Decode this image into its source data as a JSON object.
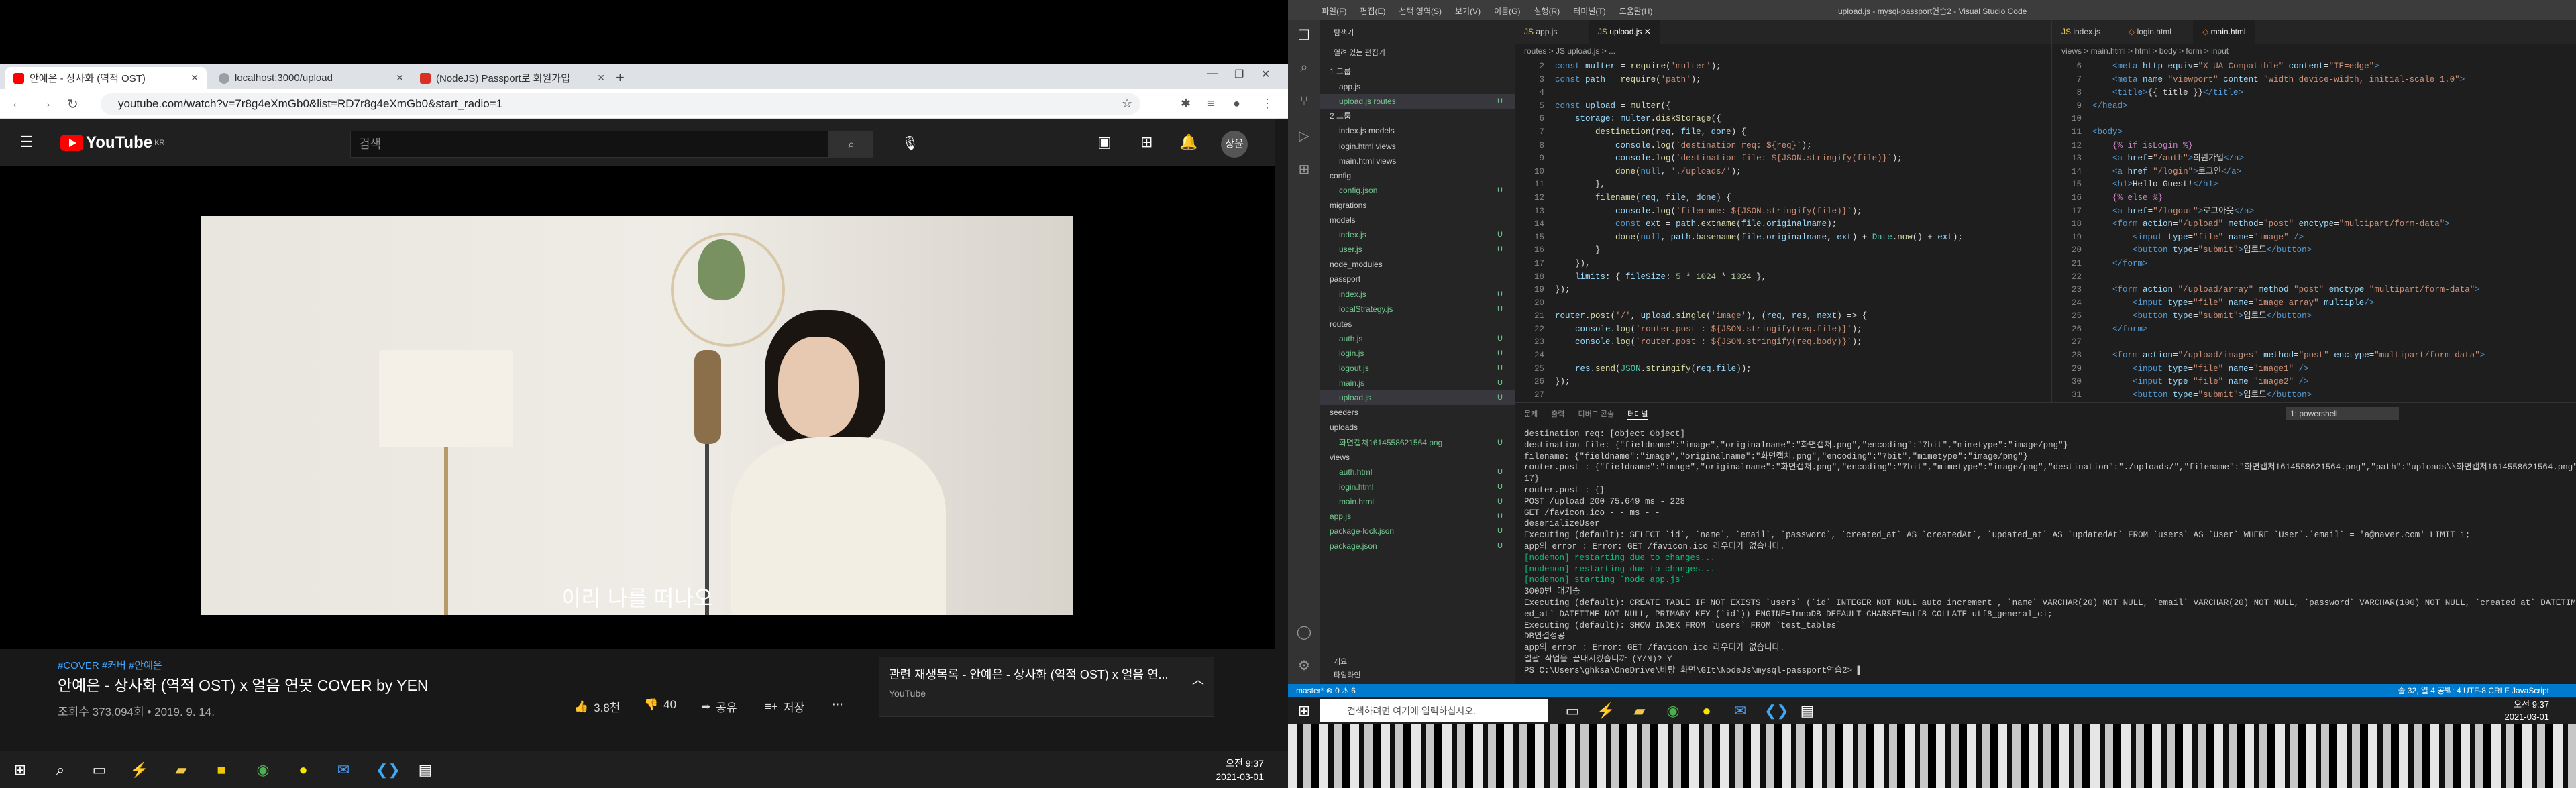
{
  "browser": {
    "tabs": [
      {
        "title": "안예은 - 상사화 (역적 OST)",
        "icon": "youtube-icon",
        "color": "#ff0000"
      },
      {
        "title": "localhost:3000/upload",
        "icon": "globe-icon",
        "color": "#5f6368"
      },
      {
        "title": "(NodeJS) Passport로 회원가입",
        "icon": "site-icon",
        "color": "#d93025"
      }
    ],
    "url": "youtube.com/watch?v=7r8g4eXmGb0&list=RD7r8g4eXmGb0&start_radio=1"
  },
  "youtube": {
    "logo_text": "YouTube",
    "logo_region": "KR",
    "search_placeholder": "검색",
    "avatar_text": "상윤",
    "caption": "이리 나를 떠나오",
    "tags": "#COVER #커버 #안예은",
    "video_title": "안예은 - 상사화 (역적 OST) x 얼음 연못 COVER by YEN",
    "views_date": "조회수 373,094회 • 2019. 9. 14.",
    "likes": "3.8천",
    "dislikes": "40",
    "share": "공유",
    "save": "저장",
    "playlist_title": "관련 재생목록 - 안예은 - 상사화 (역적 OST) x 얼음 연...",
    "playlist_sub": "YouTube"
  },
  "taskbar_left": {
    "time": "오전 9:37",
    "date": "2021-03-01"
  },
  "vscode": {
    "title": "upload.js - mysql-passport연습2 - Visual Studio Code",
    "menu": [
      "파일(F)",
      "편집(E)",
      "선택 영역(S)",
      "보기(V)",
      "이동(G)",
      "실행(R)",
      "터미널(T)",
      "도움말(H)"
    ],
    "explorer_header": "탐색기",
    "open_editors": "열려 있는 편집기",
    "project": "MYSQL-PASSPORT연습2",
    "outline": "개요",
    "timeline": "타임라인",
    "tree": [
      {
        "name": "1 그룹",
        "status": "",
        "level": 1
      },
      {
        "name": "app.js",
        "status": "",
        "level": 2
      },
      {
        "name": "upload.js routes",
        "status": "U",
        "level": 2
      },
      {
        "name": "2 그룹",
        "status": "",
        "level": 1
      },
      {
        "name": "index.js models",
        "status": "",
        "level": 2
      },
      {
        "name": "login.html views",
        "status": "",
        "level": 2
      },
      {
        "name": "main.html views",
        "status": "",
        "level": 2
      },
      {
        "name": "config",
        "status": "",
        "level": 1
      },
      {
        "name": "config.json",
        "status": "U",
        "level": 2
      },
      {
        "name": "migrations",
        "status": "",
        "level": 1
      },
      {
        "name": "models",
        "status": "",
        "level": 1
      },
      {
        "name": "index.js",
        "status": "U",
        "level": 2
      },
      {
        "name": "user.js",
        "status": "U",
        "level": 2
      },
      {
        "name": "node_modules",
        "status": "",
        "level": 1
      },
      {
        "name": "passport",
        "status": "",
        "level": 1
      },
      {
        "name": "index.js",
        "status": "U",
        "level": 2
      },
      {
        "name": "localStrategy.js",
        "status": "U",
        "level": 2
      },
      {
        "name": "routes",
        "status": "",
        "level": 1
      },
      {
        "name": "auth.js",
        "status": "U",
        "level": 2
      },
      {
        "name": "login.js",
        "status": "U",
        "level": 2
      },
      {
        "name": "logout.js",
        "status": "U",
        "level": 2
      },
      {
        "name": "main.js",
        "status": "U",
        "level": 2
      },
      {
        "name": "upload.js",
        "status": "U",
        "level": 2
      },
      {
        "name": "seeders",
        "status": "",
        "level": 1
      },
      {
        "name": "uploads",
        "status": "",
        "level": 1
      },
      {
        "name": "화면캡처1614558621564.png",
        "status": "U",
        "level": 2
      },
      {
        "name": "views",
        "status": "",
        "level": 1
      },
      {
        "name": "auth.html",
        "status": "U",
        "level": 2
      },
      {
        "name": "login.html",
        "status": "U",
        "level": 2
      },
      {
        "name": "main.html",
        "status": "U",
        "level": 2
      },
      {
        "name": "app.js",
        "status": "U",
        "level": 1
      },
      {
        "name": "package-lock.json",
        "status": "U",
        "level": 1
      },
      {
        "name": "package.json",
        "status": "U",
        "level": 1
      }
    ],
    "left_tabs": [
      "app.js",
      "upload.js"
    ],
    "left_crumb": "routes > JS upload.js > ...",
    "right_tabs": [
      "index.js",
      "login.html",
      "main.html"
    ],
    "right_crumb": "views > main.html > html > body > form > input",
    "panel_tabs": [
      "문제",
      "출력",
      "디버그 콘솔",
      "터미널"
    ],
    "terminal_select": "1: powershell",
    "status_left": "master*  ⊗ 0 ⚠ 6",
    "status_right": "줄 32, 열 4   공백: 4   UTF-8   CRLF   JavaScript"
  },
  "taskbar_right": {
    "search": "검색하려면 여기에 입력하십시오.",
    "time": "오전 9:37",
    "date": "2021-03-01"
  }
}
